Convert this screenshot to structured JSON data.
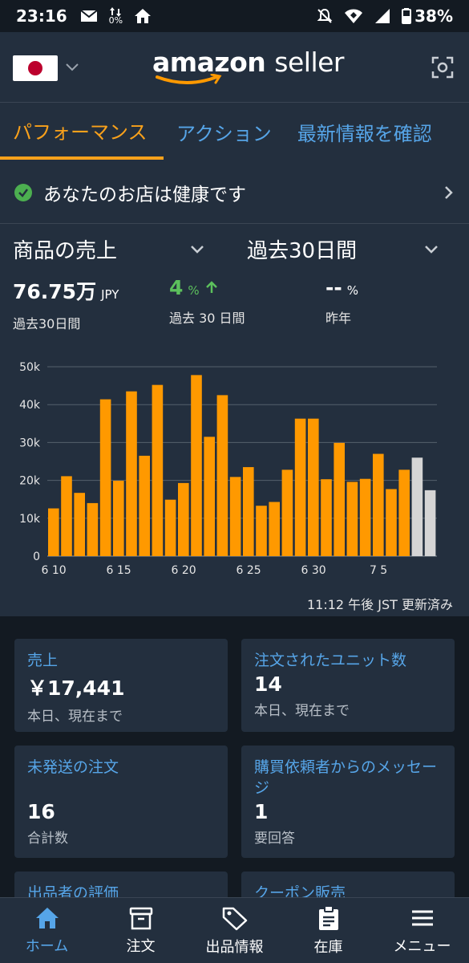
{
  "status_bar": {
    "time": "23:16",
    "battery": "38%",
    "data_label": "0%"
  },
  "header": {
    "logo_main": "amazon",
    "logo_sub": "seller"
  },
  "tabs": [
    {
      "label": "パフォーマンス",
      "active": true
    },
    {
      "label": "アクション",
      "active": false
    },
    {
      "label": "最新情報を確認",
      "active": false
    }
  ],
  "health": {
    "text": "あなたのお店は健康です"
  },
  "selectors": {
    "metric": "商品の売上",
    "period": "過去30日間"
  },
  "metrics": {
    "sales": {
      "value": "76.75万",
      "unit": "JPY",
      "sub": "過去30日間"
    },
    "change": {
      "value": "4",
      "unit": "%",
      "sub": "過去 30 日間"
    },
    "yoy": {
      "value": "--",
      "unit": "%",
      "sub": "昨年"
    }
  },
  "chart_data": {
    "type": "bar",
    "x_ticks": [
      "6 10",
      "6 15",
      "6 20",
      "6 25",
      "6 30",
      "7 5"
    ],
    "y_ticks": [
      "0",
      "10k",
      "20k",
      "30k",
      "40k",
      "50k"
    ],
    "ylim": [
      0,
      50000
    ],
    "values": [
      12600,
      21100,
      16700,
      14000,
      41400,
      19900,
      43500,
      26500,
      45200,
      14900,
      19300,
      47800,
      31500,
      42500,
      20900,
      23500,
      13300,
      14300,
      22800,
      36300,
      36300,
      20300,
      29900,
      19600,
      20400,
      27000,
      17700,
      22800,
      26000,
      17400
    ],
    "bar_colors": {
      "complete": "#ff9900",
      "partial": "#d5d5d5"
    },
    "partial_from_index": 28
  },
  "updated_text": "11:12 午後 JST 更新済み",
  "cards": [
    {
      "title": "売上",
      "value": "￥17,441",
      "sub": "本日、現在まで"
    },
    {
      "title": "注文されたユニット数",
      "value": "14",
      "sub": "本日、現在まで"
    },
    {
      "title": "未発送の注文",
      "value": "16",
      "sub": "合計数"
    },
    {
      "title": "購買依頼者からのメッセージ",
      "value": "1",
      "sub": "要回答"
    },
    {
      "title": "出品者の評価",
      "value": "",
      "sub": ""
    },
    {
      "title": "クーポン販売",
      "value": "",
      "sub": ""
    }
  ],
  "bottom_nav": [
    {
      "label": "ホーム",
      "icon": "home-icon"
    },
    {
      "label": "注文",
      "icon": "box-icon"
    },
    {
      "label": "出品情報",
      "icon": "tag-icon"
    },
    {
      "label": "在庫",
      "icon": "clipboard-icon"
    },
    {
      "label": "メニュー",
      "icon": "menu-icon"
    }
  ]
}
